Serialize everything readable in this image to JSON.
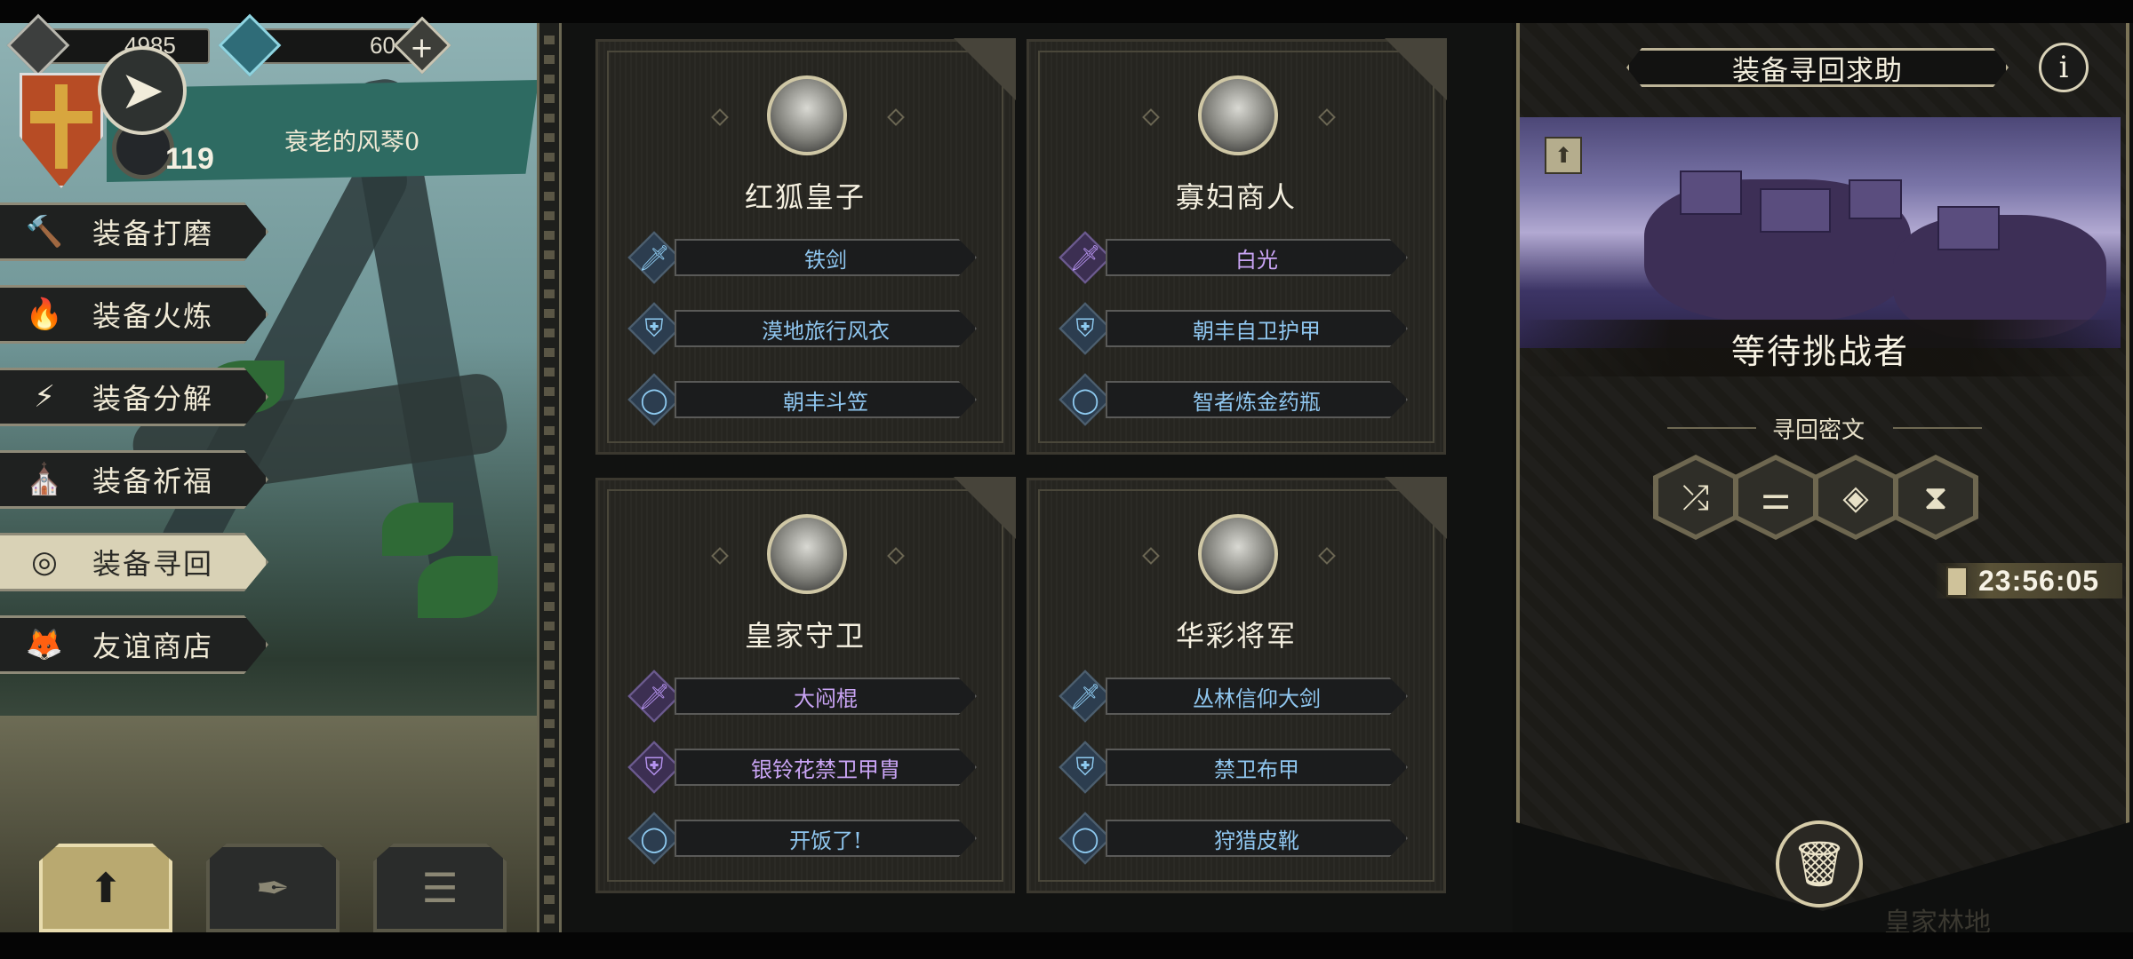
{
  "resources": {
    "currency1": "4985",
    "currency2": "60",
    "add_label": "+"
  },
  "player": {
    "level": "119",
    "banner_text": "衰老的风琴0"
  },
  "menu": [
    {
      "label": "装备打磨",
      "icon": "hammer-icon",
      "glyph": "🔨"
    },
    {
      "label": "装备火炼",
      "icon": "flame-icon",
      "glyph": "🔥"
    },
    {
      "label": "装备分解",
      "icon": "disassemble-icon",
      "glyph": "⚡"
    },
    {
      "label": "装备祈福",
      "icon": "pray-icon",
      "glyph": "⛪"
    },
    {
      "label": "装备寻回",
      "icon": "target-icon",
      "glyph": "◎",
      "active": true
    },
    {
      "label": "友谊商店",
      "icon": "fox-icon",
      "glyph": "🦊"
    }
  ],
  "bottom_tabs": [
    {
      "icon": "upload-icon",
      "glyph": "⬆",
      "active": true
    },
    {
      "icon": "feather-icon",
      "glyph": "✒"
    },
    {
      "icon": "list-icon",
      "glyph": "☰"
    }
  ],
  "cards": [
    {
      "name": "红狐皇子",
      "items": [
        {
          "label": "铁剑",
          "type": "sword",
          "rarity": "blue"
        },
        {
          "label": "漠地旅行风衣",
          "type": "armor",
          "rarity": "blue"
        },
        {
          "label": "朝丰斗笠",
          "type": "ring",
          "rarity": "blue"
        }
      ]
    },
    {
      "name": "寡妇商人",
      "items": [
        {
          "label": "白光",
          "type": "sword",
          "rarity": "purple"
        },
        {
          "label": "朝丰自卫护甲",
          "type": "armor",
          "rarity": "blue"
        },
        {
          "label": "智者炼金药瓶",
          "type": "ring",
          "rarity": "blue"
        }
      ]
    },
    {
      "name": "皇家守卫",
      "items": [
        {
          "label": "大闷棍",
          "type": "sword",
          "rarity": "purple"
        },
        {
          "label": "银铃花禁卫甲胄",
          "type": "armor",
          "rarity": "purple"
        },
        {
          "label": "开饭了!",
          "type": "ring",
          "rarity": "blue"
        }
      ]
    },
    {
      "name": "华彩将军",
      "items": [
        {
          "label": "丛林信仰大剑",
          "type": "sword",
          "rarity": "blue"
        },
        {
          "label": "禁卫布甲",
          "type": "armor",
          "rarity": "blue"
        },
        {
          "label": "狩猎皮靴",
          "type": "ring",
          "rarity": "blue"
        }
      ]
    }
  ],
  "right_panel": {
    "title": "装备寻回求助",
    "info_label": "i",
    "status": "等待挑战者",
    "cipher_label": "寻回密文",
    "cipher_glyphs": [
      "⤮",
      "⚌",
      "◈",
      "⧗"
    ],
    "timer": "23:56:05",
    "map_label": "皇家林地"
  },
  "colors": {
    "blue_item": "#8fc6ef",
    "purple_item": "#c9a4f4",
    "panel_gold": "#bcb397"
  }
}
